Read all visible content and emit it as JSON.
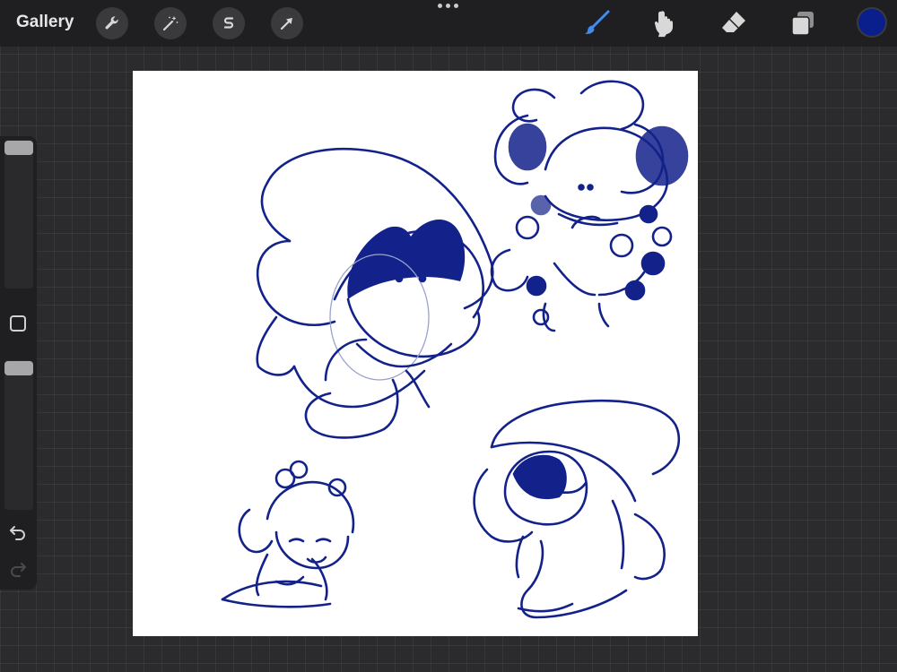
{
  "toolbar": {
    "gallery_label": "Gallery"
  },
  "tools_left": [
    {
      "icon": "wrench-icon"
    },
    {
      "icon": "magic-wand-icon"
    },
    {
      "icon": "selection-s-icon"
    },
    {
      "icon": "transform-arrow-icon"
    }
  ],
  "tools_right": [
    {
      "icon": "brush-icon",
      "active": true
    },
    {
      "icon": "smudge-icon"
    },
    {
      "icon": "eraser-icon"
    },
    {
      "icon": "layers-icon"
    }
  ],
  "colors": {
    "current": "#0b1f8c",
    "ink": "#13228a",
    "active_tool": "#3f8bf0"
  },
  "sidebar": {
    "brush_size_level": 0.95,
    "opacity_level": 0.95
  }
}
